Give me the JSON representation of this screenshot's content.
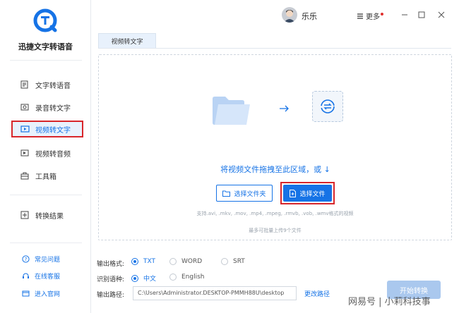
{
  "app": {
    "name": "迅捷文字转语音"
  },
  "user": {
    "name": "乐乐"
  },
  "header": {
    "more_label": "更多"
  },
  "nav": {
    "items": [
      {
        "label": "文字转语音",
        "icon": "text-to-speech-icon"
      },
      {
        "label": "录音转文字",
        "icon": "recording-icon"
      },
      {
        "label": "视频转文字",
        "icon": "video-icon",
        "active": true
      },
      {
        "label": "视频转音频",
        "icon": "video-audio-icon"
      },
      {
        "label": "工具箱",
        "icon": "toolbox-icon"
      },
      {
        "label": "转换结果",
        "icon": "result-icon"
      }
    ],
    "bottom": [
      {
        "label": "常见问题",
        "icon": "help-icon"
      },
      {
        "label": "在线客服",
        "icon": "headset-icon"
      },
      {
        "label": "进入官网",
        "icon": "website-icon"
      }
    ]
  },
  "tab": {
    "label": "视频转文字"
  },
  "dropzone": {
    "hint": "将视频文件拖拽至此区域，或 ↓",
    "select_folder": "选择文件夹",
    "select_file": "选择文件",
    "formats": "支持.avi, .mkv, .mov, .mp4, .mpeg, .rmvb, .vob, .wmv格式的视频",
    "limit": "最多可批量上传9个文件"
  },
  "options": {
    "format_label": "输出格式:",
    "format_options": [
      "TXT",
      "WORD",
      "SRT"
    ],
    "format_selected": "TXT",
    "lang_label": "识别语种:",
    "lang_options": [
      "中文",
      "English"
    ],
    "lang_selected": "中文",
    "path_label": "输出路径:",
    "path_value": "C:\\Users\\Administrator.DESKTOP-PMMH88U\\desktop",
    "change_path": "更改路径",
    "start": "开始转换"
  },
  "watermark": "网易号 | 小莉科技事",
  "colors": {
    "accent": "#1673e6",
    "highlight": "#d8262b"
  }
}
